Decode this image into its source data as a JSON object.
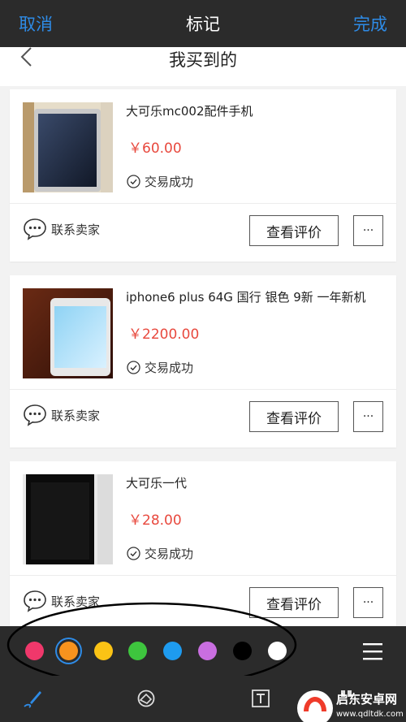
{
  "topbar": {
    "cancel": "取消",
    "title": "标记",
    "done": "完成"
  },
  "subheader": {
    "title": "我买到的",
    "back_icon": "chevron-left-icon"
  },
  "orders": [
    {
      "title": "大可乐mc002配件手机",
      "price": "￥60.00",
      "status": "交易成功",
      "contact": "联系卖家",
      "review": "查看评价",
      "more": "···"
    },
    {
      "title": "iphone6 plus 64G 国行 银色 9新 一年新机",
      "price": "￥2200.00",
      "status": "交易成功",
      "contact": "联系卖家",
      "review": "查看评价",
      "more": "···"
    },
    {
      "title": "大可乐一代",
      "price": "￥28.00",
      "status": "交易成功",
      "contact": "联系卖家",
      "review": "查看评价",
      "more": "···"
    }
  ],
  "palette": {
    "colors": [
      "#f0386b",
      "#f7931e",
      "#fbc315",
      "#3ec53e",
      "#1e9bef",
      "#c96ee0",
      "#000000",
      "#ffffff"
    ],
    "selected_index": 1,
    "menu_icon": "hamburger-menu-icon"
  },
  "tools": [
    "pen-icon",
    "eraser-icon",
    "text-icon",
    "mosaic-icon"
  ],
  "watermark": {
    "name": "启东安卓网",
    "url": "www.qdltdk.com"
  },
  "colors": {
    "accent": "#2e8be6",
    "price": "#e8493e",
    "dark_bar": "#2b2b2b"
  }
}
